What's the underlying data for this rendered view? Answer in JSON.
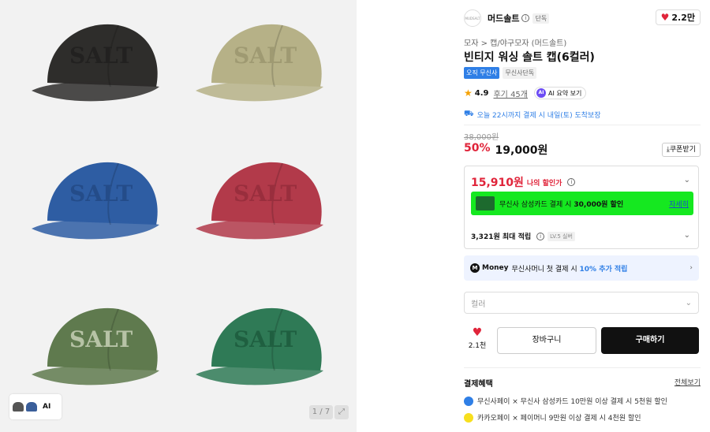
{
  "gallery": {
    "caps": [
      {
        "color": "#2e2d2b",
        "text_color": "#222120"
      },
      {
        "color": "#b6b187",
        "text_color": "#9f9a72"
      },
      {
        "color": "#2e5da3",
        "text_color": "#244c89"
      },
      {
        "color": "#b23a4a",
        "text_color": "#992e3d"
      },
      {
        "color": "#5f7a4e",
        "text_color": "#b7c3a6"
      },
      {
        "color": "#2f7a56",
        "text_color": "#1f5f40"
      }
    ],
    "cap_text": "SALT",
    "thumb_label": "AI",
    "counter": "1 / 7"
  },
  "brand": {
    "name": "머드솔트",
    "logo_text": "MUDSALT",
    "exclusive": "단독",
    "likes": "2.2만"
  },
  "breadcrumb": "모자 > 캡/야구모자 (머드솔트)",
  "product": {
    "title": "빈티지 워싱 솔트 캡(6컬러)",
    "badge_primary": "오직 무신사",
    "badge_secondary": "무신사단독",
    "rating": "4.9",
    "reviews": "후기 45개",
    "ai_summary": "AI 요약 보기",
    "delivery": "오늘 22시까지 결제 시 내일(토) 도착보장",
    "original_price": "38,000원",
    "discount": "50%",
    "price": "19,000원",
    "coupon_btn": "쿠폰받기"
  },
  "benefit": {
    "my_price": "15,910원",
    "my_price_label": "나의 할인가",
    "card_text": "무신사 삼성카드 결제 시",
    "card_amount": "30,000원 할인",
    "card_link": "자세히",
    "points": "3,321원 최대 적립",
    "level": "LV.5 실버"
  },
  "money": {
    "label": "Money",
    "text": "무신사머니 첫 결제 시",
    "highlight": "10% 추가 적립"
  },
  "option": {
    "placeholder": "컬러"
  },
  "actions": {
    "wish_count": "2.1천",
    "cart": "장바구니",
    "buy": "구매하기"
  },
  "payment": {
    "title": "결제혜택",
    "more": "전체보기",
    "rows": [
      {
        "text": "무신사페이 × 무신사 삼성카드 10만원 이상 결제 시 5천원 할인",
        "color": "#2f7fe6"
      },
      {
        "text": "카카오페이 × 페이머니 9만원 이상 결제 시 4천원 할인",
        "color": "#f7df1e"
      }
    ]
  },
  "colors": {
    "accent_red": "#e0243a",
    "accent_blue": "#2f7fe6",
    "banner_green": "#15e820"
  }
}
